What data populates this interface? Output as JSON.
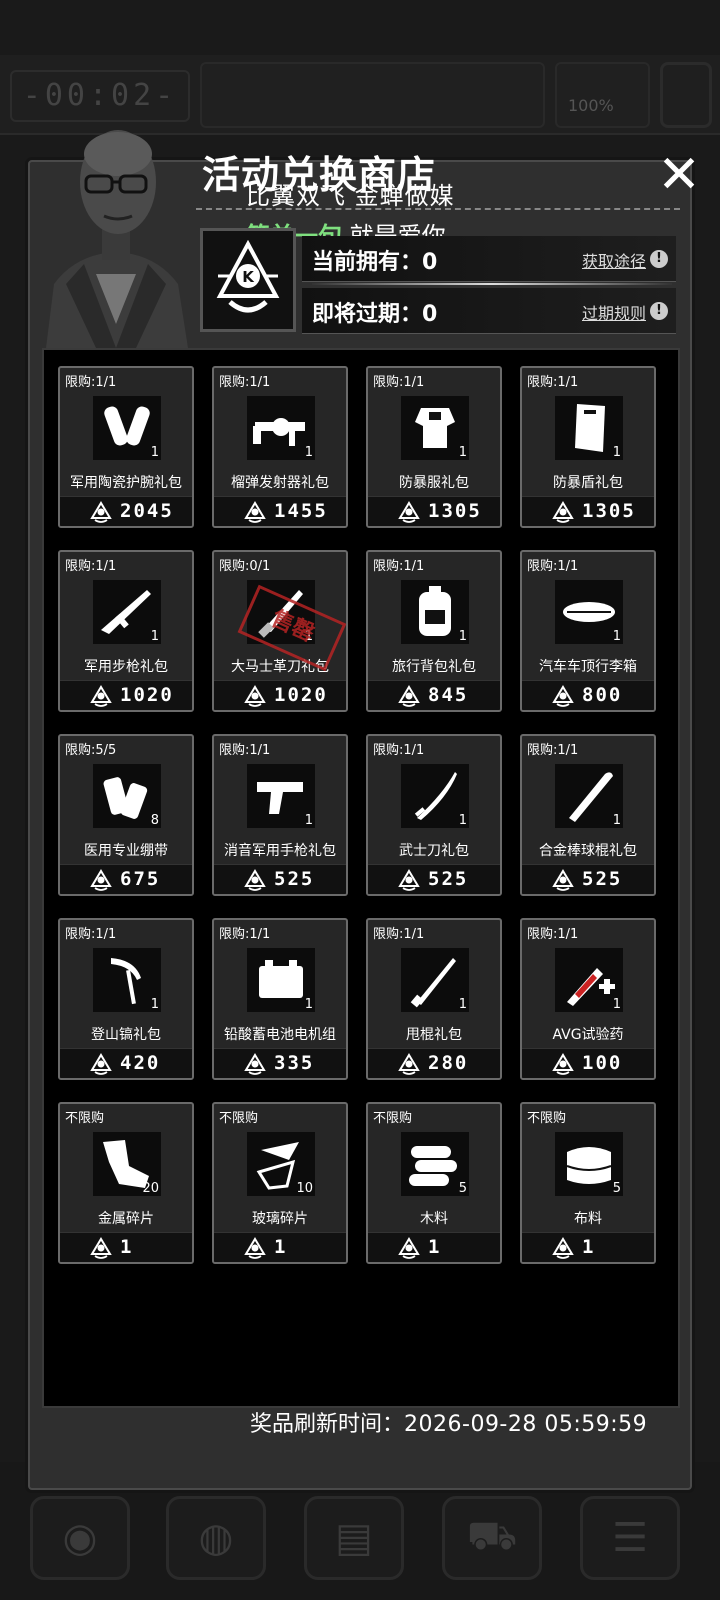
{
  "hud": {
    "timer": "-00:02-",
    "percent": "100%"
  },
  "shop": {
    "title": "活动兑换商店",
    "close_icon": "close-icon",
    "current_label": "当前拥有：",
    "current_value": "0",
    "current_link": "获取途径",
    "expire_label": "即将过期：",
    "expire_value": "0",
    "expire_link": "过期规则",
    "refresh_label": "奖品刷新时间：",
    "refresh_time": "2026-09-28 05:59:59"
  },
  "overlay": {
    "line1": "比翼双飞 金蝉做媒",
    "line2_green": "简单一句",
    "line2_white": "就是爱你"
  },
  "items": [
    {
      "limit": "限购:1/1",
      "name": "军用陶瓷护腕礼包",
      "qty": "1",
      "price": "2045",
      "icon": "armguard-icon"
    },
    {
      "limit": "限购:1/1",
      "name": "榴弹发射器礼包",
      "qty": "1",
      "price": "1455",
      "icon": "grenade-launcher-icon"
    },
    {
      "limit": "限购:1/1",
      "name": "防暴服礼包",
      "qty": "1",
      "price": "1305",
      "icon": "riot-suit-icon"
    },
    {
      "limit": "限购:1/1",
      "name": "防暴盾礼包",
      "qty": "1",
      "price": "1305",
      "icon": "riot-shield-icon"
    },
    {
      "limit": "限购:1/1",
      "name": "军用步枪礼包",
      "qty": "1",
      "price": "1020",
      "icon": "rifle-icon"
    },
    {
      "limit": "限购:0/1",
      "name": "大马士革刀礼包",
      "qty": "1",
      "price": "1020",
      "icon": "damascus-knife-icon",
      "sold": "售罄"
    },
    {
      "limit": "限购:1/1",
      "name": "旅行背包礼包",
      "qty": "1",
      "price": "845",
      "icon": "backpack-icon"
    },
    {
      "limit": "限购:1/1",
      "name": "汽车车顶行李箱",
      "qty": "1",
      "price": "800",
      "icon": "roof-box-icon"
    },
    {
      "limit": "限购:5/5",
      "name": "医用专业绷带",
      "qty": "8",
      "price": "675",
      "icon": "bandage-icon"
    },
    {
      "limit": "限购:1/1",
      "name": "消音军用手枪礼包",
      "qty": "1",
      "price": "525",
      "icon": "pistol-icon"
    },
    {
      "limit": "限购:1/1",
      "name": "武士刀礼包",
      "qty": "1",
      "price": "525",
      "icon": "katana-icon"
    },
    {
      "limit": "限购:1/1",
      "name": "合金棒球棍礼包",
      "qty": "1",
      "price": "525",
      "icon": "baseball-bat-icon"
    },
    {
      "limit": "限购:1/1",
      "name": "登山镐礼包",
      "qty": "1",
      "price": "420",
      "icon": "ice-axe-icon"
    },
    {
      "limit": "限购:1/1",
      "name": "铅酸蓄电池电机组",
      "qty": "1",
      "price": "335",
      "icon": "battery-icon"
    },
    {
      "limit": "限购:1/1",
      "name": "甩棍礼包",
      "qty": "1",
      "price": "280",
      "icon": "baton-icon"
    },
    {
      "limit": "限购:1/1",
      "name": "AVG试验药",
      "qty": "1",
      "price": "100",
      "icon": "syringe-icon"
    },
    {
      "limit": "不限购",
      "name": "金属碎片",
      "qty": "20",
      "price": "1",
      "icon": "metal-scrap-icon"
    },
    {
      "limit": "不限购",
      "name": "玻璃碎片",
      "qty": "10",
      "price": "1",
      "icon": "glass-shard-icon"
    },
    {
      "limit": "不限购",
      "name": "木料",
      "qty": "5",
      "price": "1",
      "icon": "wood-icon"
    },
    {
      "limit": "不限购",
      "name": "布料",
      "qty": "5",
      "price": "1",
      "icon": "cloth-icon"
    }
  ],
  "colors": {
    "accent_green": "#7fe07f",
    "sold_red": "#b52424"
  }
}
